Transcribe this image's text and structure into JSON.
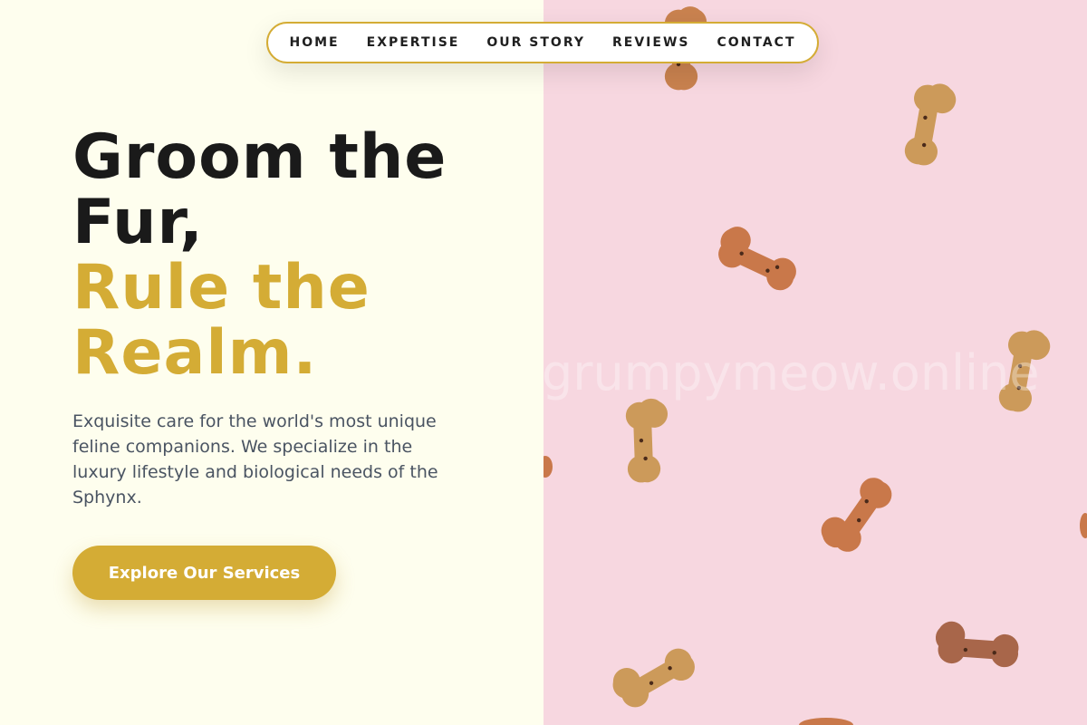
{
  "nav": {
    "items": [
      {
        "label": "HOME"
      },
      {
        "label": "EXPERTISE"
      },
      {
        "label": "OUR STORY"
      },
      {
        "label": "REVIEWS"
      },
      {
        "label": "CONTACT"
      }
    ]
  },
  "hero": {
    "title_line1": "Groom the",
    "title_line2": "Fur,",
    "title_line3": "Rule the",
    "title_line4": "Realm.",
    "description": "Exquisite care for the world's most unique feline companions. We specialize in the luxury lifestyle and biological needs of the Sphynx.",
    "cta_label": "Explore Our Services"
  },
  "photo": {
    "watermark": "grumpymeow.online",
    "subject": "dog bone biscuits on pink background"
  },
  "colors": {
    "accent": "#d4ac35",
    "left_background": "#fefeee",
    "photo_background": "#f7d7e0",
    "heading": "#1a1a1a",
    "body_text": "#4a5462"
  }
}
